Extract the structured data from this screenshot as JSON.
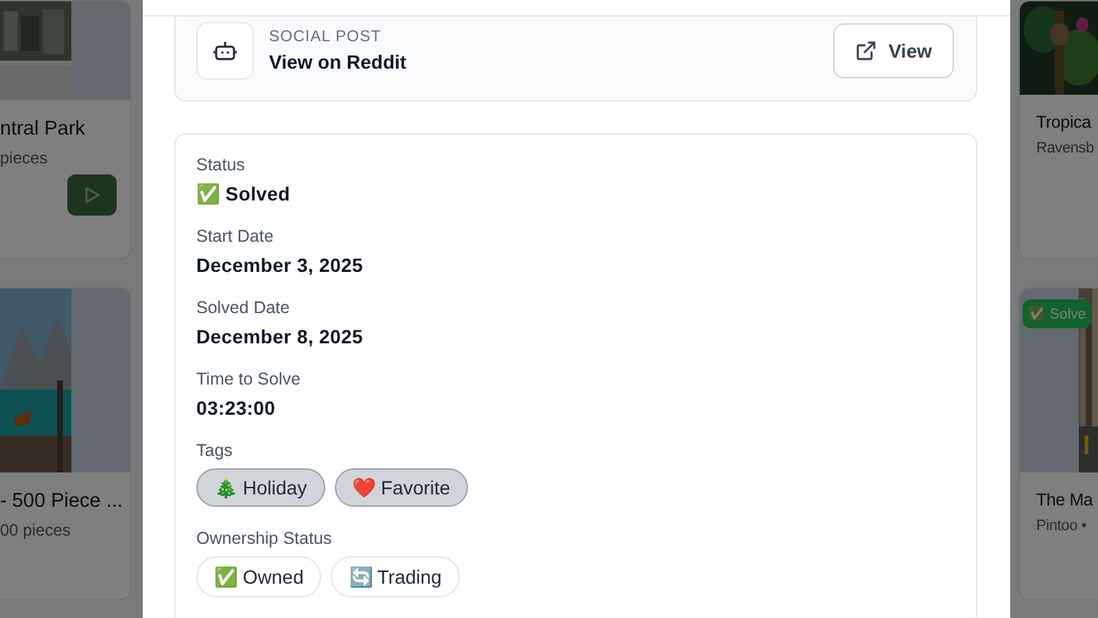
{
  "background_cards": {
    "left": [
      {
        "title": "ntral Park",
        "subtitle": "pieces",
        "play_button": true
      },
      {
        "title": "- 500 Piece ...",
        "subtitle": "00 pieces",
        "play_button": false
      }
    ],
    "right": [
      {
        "title": "Tropica",
        "subtitle": "Ravensb"
      },
      {
        "title": "The Ma",
        "subtitle": "Pintoo •",
        "badge": "✅ Solve"
      }
    ]
  },
  "social_post": {
    "label": "SOCIAL POST",
    "title": "View on Reddit",
    "button": "View"
  },
  "details": [
    {
      "kind": "text",
      "label": "Status",
      "value": "✅ Solved"
    },
    {
      "kind": "text",
      "label": "Start Date",
      "value": "December 3, 2025"
    },
    {
      "kind": "text",
      "label": "Solved Date",
      "value": "December 8, 2025"
    },
    {
      "kind": "text",
      "label": "Time to Solve",
      "value": "03:23:00"
    },
    {
      "kind": "chips",
      "label": "Tags",
      "chips": [
        {
          "text": "🎄 Holiday",
          "filled": true
        },
        {
          "text": "❤️ Favorite",
          "filled": true
        }
      ]
    },
    {
      "kind": "chips",
      "label": "Ownership Status",
      "chips": [
        {
          "text": "✅ Owned",
          "filled": false
        },
        {
          "text": "🔄 Trading",
          "filled": false
        }
      ]
    }
  ]
}
